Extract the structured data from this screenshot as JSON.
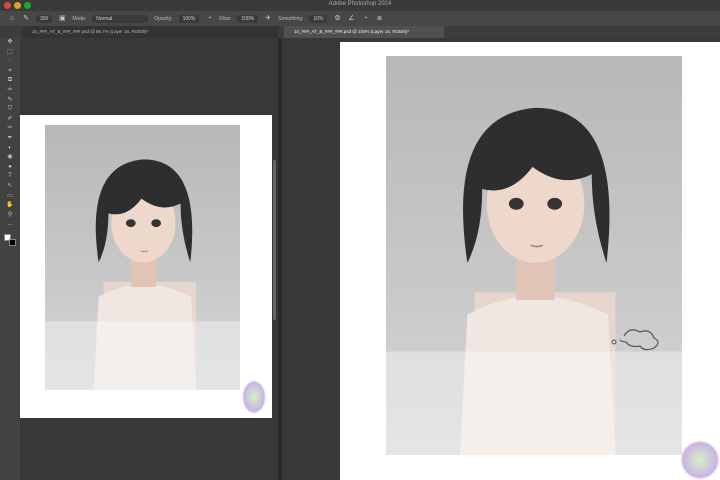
{
  "app": {
    "title": "Adobe Photoshop 2024"
  },
  "options": {
    "mode_label": "Mode:",
    "mode_value": "Normal",
    "opacity_label": "Opacity:",
    "opacity_value": "100%",
    "flow_label": "Flow:",
    "flow_value": "100%",
    "smoothing_label": "Smoothing:",
    "smoothing_value": "10%",
    "size_value": "300"
  },
  "tabs": [
    {
      "label": "10_###_AT_B_###_###.psd @ 66.7% (Layer 16, RGB/8)*"
    },
    {
      "label": "10_###_AT_B_###_###.psd @ 100% (Layer 16, RGB/8)*"
    }
  ],
  "tools": [
    "✥",
    "⬚",
    "◌",
    "⌖",
    "⧉",
    "✑",
    "✎",
    "⛉",
    "✐",
    "✂",
    "✒",
    "◐",
    "◉",
    "●",
    "T",
    "↖",
    "▭",
    "✋",
    "⚲",
    "…"
  ],
  "colors": {
    "accent": "#505050",
    "background": "#383838",
    "toolbar": "#424242"
  }
}
